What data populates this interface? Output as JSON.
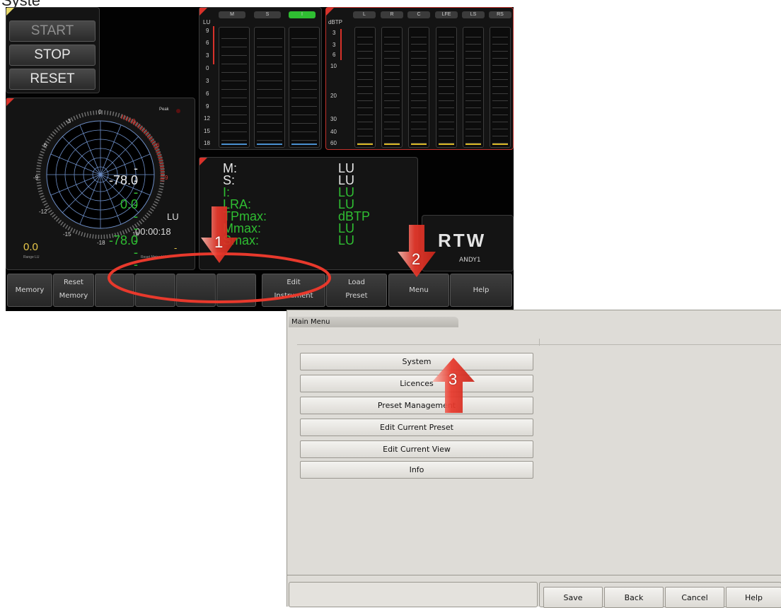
{
  "cutoff_heading": "Syste",
  "meter": {
    "transport": {
      "start": "START",
      "stop": "STOP",
      "reset": "RESET"
    },
    "radar": {
      "ticks": [
        "0",
        "-3",
        "3",
        "-6",
        "6",
        "-9",
        "9",
        "-12",
        "-15",
        "-18",
        "18"
      ],
      "peak_label": "Peak",
      "unit": "LU",
      "time": "00:00:18",
      "range_value": "0.0",
      "range_label": "Range LU",
      "right_dash": "-",
      "right_caption": "Reset Meter LU"
    },
    "lu_panel": {
      "unit": "LU",
      "tabs": [
        "M",
        "S",
        "I"
      ],
      "scale": [
        "9",
        "6",
        "3",
        "0",
        "3",
        "6",
        "9",
        "12",
        "15",
        "18"
      ]
    },
    "tp_panel": {
      "unit": "dBTP",
      "tabs": [
        "L",
        "R",
        "C",
        "LFE",
        "LS",
        "RS"
      ],
      "scale": [
        "3",
        "3",
        "6",
        "10",
        "20",
        "30",
        "40",
        "60"
      ]
    },
    "readout": [
      {
        "key": "M:",
        "value": "----",
        "unit": "LU"
      },
      {
        "key": "S:",
        "value": "-78.0",
        "unit": "LU"
      },
      {
        "key": "I:",
        "value": "----",
        "unit": "LU"
      },
      {
        "key": "LRA:",
        "value": "0.0",
        "unit": "LU"
      },
      {
        "key": "TPmax:",
        "value": "----",
        "unit": "dBTP"
      },
      {
        "key": "Mmax:",
        "value": "----",
        "unit": "LU"
      },
      {
        "key": "Smax:",
        "value": "-78.0",
        "unit": "LU"
      }
    ],
    "logo": {
      "brand": "RTW",
      "device": "ANDY1"
    },
    "softkeys": {
      "memory": "Memory",
      "reset_memory_1": "Reset",
      "reset_memory_2": "Memory",
      "edit_1": "Edit",
      "edit_2": "Instrument",
      "load_1": "Load",
      "load_2": "Preset",
      "menu": "Menu",
      "help": "Help"
    }
  },
  "annotations": {
    "step1": "1",
    "step2": "2",
    "step3": "3",
    "arrow_color": "#e8392c"
  },
  "main_menu": {
    "title": "Main Menu",
    "items": [
      "System",
      "Licences",
      "Preset Management",
      "Edit Current Preset",
      "Edit Current View",
      "Info"
    ],
    "footer": {
      "save": "Save",
      "back": "Back",
      "cancel": "Cancel",
      "help": "Help"
    }
  },
  "colors": {
    "meter_green": "#2fbe32",
    "meter_red": "#d8322a",
    "readout_white": "#e8e8e8"
  }
}
